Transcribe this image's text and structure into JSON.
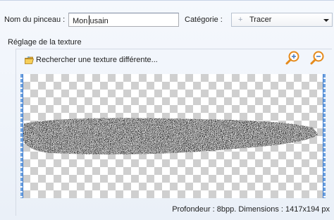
{
  "brush": {
    "name_label": "Nom du pinceau :",
    "name_value_before_caret": "Mon ",
    "name_value_after_caret": "usain",
    "category_label": "Catégorie :",
    "category_value": "Tracer"
  },
  "texture": {
    "section_title": "Réglage de la texture",
    "search_link": "Rechercher une texture différente...",
    "status": "Profondeur : 8bpp. Dimensions : 1417x194 px"
  },
  "icons": {
    "folder": "folder-icon",
    "zoom_in": "zoom-in-icon",
    "zoom_out": "zoom-out-icon",
    "category_bullet": "plus-icon"
  },
  "colors": {
    "accent": "#3a78cc",
    "zoom_orange": "#e58a1b"
  }
}
